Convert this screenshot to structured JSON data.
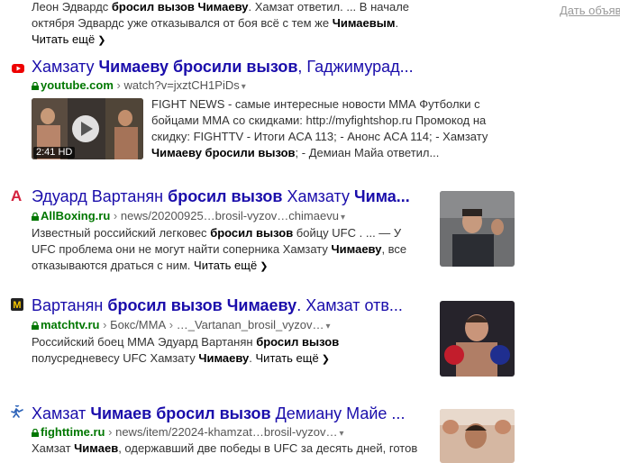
{
  "ad_link": "Дать объяв",
  "results": [
    {
      "snippet_parts": [
        [
          "Леон Эдвардс ",
          false
        ],
        [
          "бросил вызов",
          true
        ],
        [
          " ",
          false
        ],
        [
          "Чимаеву",
          true
        ],
        [
          ". Хамзат ответил. ... В начале октября Эдвардс уже отказывался от боя всё с тем же ",
          false
        ],
        [
          "Чимаевым",
          true
        ],
        [
          ". ",
          false
        ]
      ],
      "more": "Читать ещё"
    },
    {
      "title_parts": [
        [
          "Хамзату ",
          false
        ],
        [
          "Чимаеву бросили вызов",
          true
        ],
        [
          ", Гаджимурад...",
          false
        ]
      ],
      "domain": "youtube.com",
      "path": "watch?v=jxztCH1PiDs",
      "video_duration": "2:41",
      "video_quality": "HD",
      "snippet_parts": [
        [
          "FIGHT NEWS - самые интересные новости ММА Футболки с бойцами ММА со скидками: http://myfightshop.ru Промокод на скидку: FIGHTTV - Итоги ACA 113; - Анонс ACA 114; - Хамзату ",
          false
        ],
        [
          "Чимаеву бросили вызов",
          true
        ],
        [
          "; - Демиан Майа ответил...",
          false
        ]
      ]
    },
    {
      "title_parts": [
        [
          "Эдуард Вартанян ",
          false
        ],
        [
          "бросил вызов",
          true
        ],
        [
          " Хамзату ",
          false
        ],
        [
          "Чима...",
          true
        ]
      ],
      "domain": "AllBoxing.ru",
      "path": "news/20200925…brosil-vyzov…chimaevu",
      "snippet_parts": [
        [
          "Известный российский легковес ",
          false
        ],
        [
          "бросил вызов",
          true
        ],
        [
          " бойцу UFC . ... — У UFC проблема они не могут найти соперника Хамзату ",
          false
        ],
        [
          "Чимаеву",
          true
        ],
        [
          ", все отказываются драться с ним. ",
          false
        ]
      ],
      "more": "Читать ещё"
    },
    {
      "title_parts": [
        [
          "Вартанян ",
          false
        ],
        [
          "бросил вызов",
          true
        ],
        [
          " ",
          false
        ],
        [
          "Чимаеву",
          true
        ],
        [
          ". Хамзат отв...",
          false
        ]
      ],
      "domain": "matchtv.ru",
      "path_parts": [
        "Бокс/ММА",
        "…_Vartanan_brosil_vyzov…"
      ],
      "snippet_parts": [
        [
          "Российский боец ММА Эдуард Вартанян ",
          false
        ],
        [
          "бросил вызов",
          true
        ],
        [
          " полусредневесу UFC Хамзату ",
          false
        ],
        [
          "Чимаеву",
          true
        ],
        [
          ". ",
          false
        ]
      ],
      "more": "Читать ещё"
    },
    {
      "title_parts": [
        [
          "Хамзат ",
          false
        ],
        [
          "Чимаев бросил вызов",
          true
        ],
        [
          " Демиану Майе ...",
          false
        ]
      ],
      "domain": "fighttime.ru",
      "path": "news/item/22024-khamzat…brosil-vyzov…",
      "snippet_parts": [
        [
          "Хамзат ",
          false
        ],
        [
          "Чимаев",
          true
        ],
        [
          ", одержавший две победы в UFC за десять дней, готов",
          false
        ]
      ]
    }
  ],
  "colors": {
    "title": "#1a0dab",
    "domain": "#007700",
    "text": "#333333"
  }
}
